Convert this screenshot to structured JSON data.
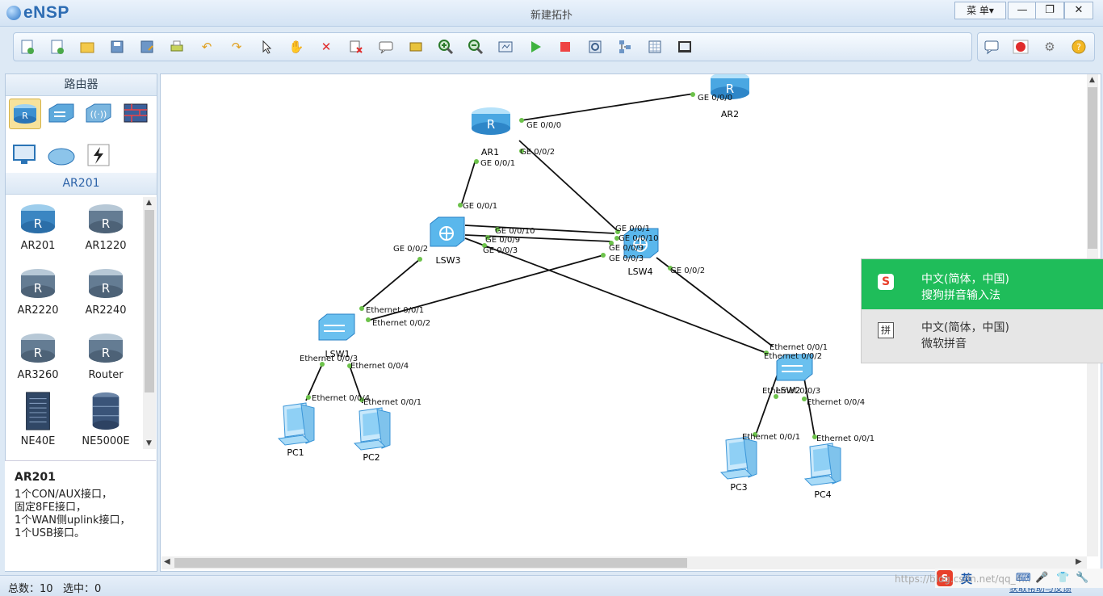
{
  "app": {
    "name": "eNSP",
    "window_title": "新建拓扑",
    "menu_label": "菜 单▾"
  },
  "window_controls": {
    "minimize": "—",
    "restore": "❐",
    "close": "✕"
  },
  "toolbar": {
    "icons": [
      "new-topology-icon",
      "new-example-icon",
      "open-icon",
      "save-icon",
      "save-as-icon",
      "print-icon",
      "undo-icon",
      "redo-icon",
      "select-icon",
      "pan-hand-icon",
      "delete-icon",
      "delete-links-icon",
      "text-note-icon",
      "palette-icon",
      "zoom-in-icon",
      "zoom-out-icon",
      "fit-icon",
      "start-device-icon",
      "stop-device-icon",
      "capture-icon",
      "topology-icon",
      "grid-icon",
      "screenshot-icon"
    ],
    "right_icons": [
      "chat-icon",
      "huawei-icon",
      "settings-icon",
      "help-icon"
    ]
  },
  "left_panel": {
    "category_title": "路由器",
    "categories": [
      "router-category-icon",
      "switch-category-icon",
      "wlan-category-icon",
      "firewall-category-icon",
      "pc-category-icon",
      "cloud-category-icon",
      "cable-category-icon"
    ],
    "subsection_title": "AR201",
    "devices": [
      {
        "label": "AR201",
        "icon": "router-icon"
      },
      {
        "label": "AR1220",
        "icon": "router-icon"
      },
      {
        "label": "AR2220",
        "icon": "router-icon"
      },
      {
        "label": "AR2240",
        "icon": "router-icon"
      },
      {
        "label": "AR3260",
        "icon": "router-icon"
      },
      {
        "label": "Router",
        "icon": "router-icon"
      },
      {
        "label": "NE40E",
        "icon": "ne40e-chassis-icon"
      },
      {
        "label": "NE5000E",
        "icon": "ne5000e-router-icon"
      }
    ],
    "description": {
      "title": "AR201",
      "lines": [
        "1个CON/AUX接口，",
        "固定8FE接口，",
        "1个WAN侧uplink接口，",
        "1个USB接口。"
      ]
    }
  },
  "topology": {
    "nodes": [
      {
        "id": "AR1",
        "label": "AR1",
        "type": "router"
      },
      {
        "id": "AR2",
        "label": "AR2",
        "type": "router"
      },
      {
        "id": "LSW3",
        "label": "LSW3",
        "type": "l3switch"
      },
      {
        "id": "LSW4",
        "label": "LSW4",
        "type": "l3switch"
      },
      {
        "id": "LSW1",
        "label": "LSW1",
        "type": "switch"
      },
      {
        "id": "LSW2",
        "label": "LSW2",
        "type": "switch"
      },
      {
        "id": "PC1",
        "label": "PC1",
        "type": "pc"
      },
      {
        "id": "PC2",
        "label": "PC2",
        "type": "pc"
      },
      {
        "id": "PC3",
        "label": "PC3",
        "type": "pc"
      },
      {
        "id": "PC4",
        "label": "PC4",
        "type": "pc"
      }
    ],
    "port_labels": [
      "GE 0/0/0",
      "GE 0/0/0",
      "GE 0/0/2",
      "GE 0/0/1",
      "GE 0/0/1",
      "GE 0/0/10",
      "GE 0/0/9",
      "GE 0/0/3",
      "GE 0/0/2",
      "GE 0/0/1",
      "GE 0/0/10",
      "GE 0/0/9",
      "GE 0/0/3",
      "GE 0/0/2",
      "Ethernet 0/0/1",
      "Ethernet 0/0/2",
      "Ethernet 0/0/3",
      "Ethernet 0/0/4",
      "Ethernet 0/0/4",
      "Ethernet 0/0/1",
      "Ethernet 0/0/1",
      "Ethernet 0/0/2",
      "Ethernet 0/0/3",
      "Ethernet 0/0/4",
      "Ethernet 0/0/1",
      "Ethernet 0/0/1"
    ]
  },
  "ime_popup": {
    "item1_line1": "中文(简体，中国)",
    "item1_line2": "搜狗拼音输入法",
    "item1_icon": "sogou-icon",
    "item2_line1": "中文(简体，中国)",
    "item2_line2": "微软拼音",
    "item2_icon": "pinyin-icon",
    "item2_glyph": "拼"
  },
  "status_bar": {
    "total_label": "总数：",
    "total_value": "10",
    "selected_label": "选中：",
    "selected_value": "0"
  },
  "tray": {
    "lang": "英",
    "watermark": "https://blog.csdn.net/qq_4...",
    "link_text": "获取帮助与反馈"
  },
  "colors": {
    "accent_green": "#1fbd5a",
    "port_dot": "#6cc24a",
    "device_blue": "#3c97d6"
  }
}
